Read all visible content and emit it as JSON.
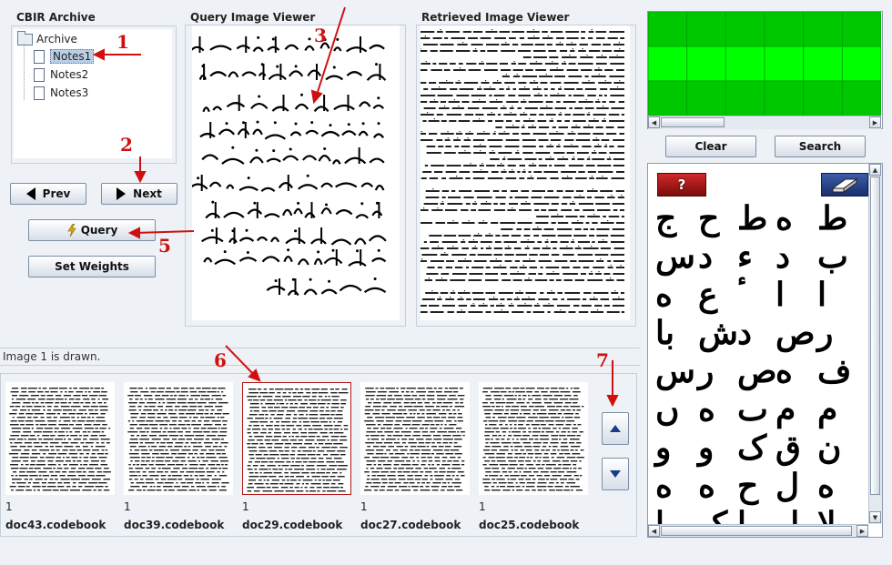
{
  "archive": {
    "title": "CBIR Archive",
    "root_label": "Archive",
    "items": [
      "Notes1",
      "Notes2",
      "Notes3"
    ]
  },
  "query_viewer": {
    "title": "Query Image Viewer"
  },
  "retrieved_viewer": {
    "title": "Retrieved Image Viewer"
  },
  "buttons": {
    "prev": "Prev",
    "next": "Next",
    "query": "Query",
    "set_weights": "Set Weights",
    "clear": "Clear",
    "search": "Search"
  },
  "status": "Image 1 is drawn.",
  "annotations": [
    "1",
    "2",
    "3",
    "5",
    "6",
    "7"
  ],
  "results": [
    {
      "num": "1",
      "name": "doc43.codebook"
    },
    {
      "num": "1",
      "name": "doc39.codebook"
    },
    {
      "num": "1",
      "name": "doc29.codebook",
      "selected": true
    },
    {
      "num": "1",
      "name": "doc27.codebook"
    },
    {
      "num": "1",
      "name": "doc25.codebook"
    }
  ],
  "colors": {
    "grid_dark": "#00c800",
    "grid_bright": "#00ff00",
    "annotation": "#d01010",
    "selected_border": "#b01818"
  },
  "icons": {
    "prev": "triangle-left-icon",
    "next": "triangle-right-icon",
    "query": "lightning-icon",
    "help": "question-mark-icon",
    "eraser": "eraser-icon",
    "scroll_up": "arrow-up-icon",
    "scroll_down": "arrow-down-icon"
  }
}
